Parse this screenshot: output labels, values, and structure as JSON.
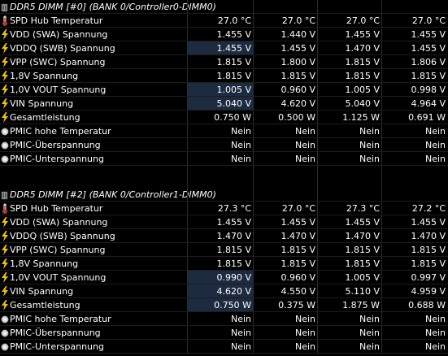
{
  "sections": [
    {
      "title": "DDR5 DIMM [#0] (BANK 0/Controller0-DIMM0)",
      "rows": [
        {
          "label": "SPD Hub Temperatur",
          "icon": "thermometer-icon",
          "values": [
            "27.0 °C",
            "27.0 °C",
            "27.0 °C",
            "27.0 °C"
          ]
        },
        {
          "label": "VDD (SWA) Spannung",
          "icon": "lightning-icon",
          "values": [
            "1.455 V",
            "1.440 V",
            "1.455 V",
            "1.455 V"
          ]
        },
        {
          "label": "VDDQ (SWB) Spannung",
          "icon": "lightning-icon",
          "values": [
            "1.455 V",
            "1.455 V",
            "1.470 V",
            "1.455 V"
          ],
          "highlight": true
        },
        {
          "label": "VPP (SWC) Spannung",
          "icon": "lightning-icon",
          "values": [
            "1.815 V",
            "1.800 V",
            "1.815 V",
            "1.806 V"
          ]
        },
        {
          "label": "1,8V Spannung",
          "icon": "lightning-icon",
          "values": [
            "1.815 V",
            "1.815 V",
            "1.815 V",
            "1.815 V"
          ]
        },
        {
          "label": "1,0V VOUT Spannung",
          "icon": "lightning-icon",
          "values": [
            "1.005 V",
            "0.960 V",
            "1.005 V",
            "0.998 V"
          ],
          "highlight": true
        },
        {
          "label": "VIN Spannung",
          "icon": "lightning-icon",
          "values": [
            "5.040 V",
            "4.620 V",
            "5.040 V",
            "4.964 V"
          ],
          "highlight": true
        },
        {
          "label": "Gesamtleistung",
          "icon": "lightning-icon",
          "values": [
            "0.750 W",
            "0.500 W",
            "1.125 W",
            "0.691 W"
          ]
        },
        {
          "label": "PMIC hohe Temperatur",
          "icon": "status-circle-icon",
          "values": [
            "Nein",
            "Nein",
            "Nein",
            "Nein"
          ]
        },
        {
          "label": "PMIC-Überspannung",
          "icon": "status-circle-icon",
          "values": [
            "Nein",
            "Nein",
            "Nein",
            "Nein"
          ]
        },
        {
          "label": "PMIC-Unterspannung",
          "icon": "status-circle-icon",
          "values": [
            "Nein",
            "Nein",
            "Nein",
            "Nein"
          ]
        }
      ]
    },
    {
      "title": "DDR5 DIMM [#2] (BANK 0/Controller1-DIMM0)",
      "rows": [
        {
          "label": "SPD Hub Temperatur",
          "icon": "thermometer-icon",
          "values": [
            "27.3 °C",
            "27.0 °C",
            "27.3 °C",
            "27.2 °C"
          ]
        },
        {
          "label": "VDD (SWA) Spannung",
          "icon": "lightning-icon",
          "values": [
            "1.455 V",
            "1.455 V",
            "1.455 V",
            "1.455 V"
          ]
        },
        {
          "label": "VDDQ (SWB) Spannung",
          "icon": "lightning-icon",
          "values": [
            "1.470 V",
            "1.470 V",
            "1.470 V",
            "1.470 V"
          ]
        },
        {
          "label": "VPP (SWC) Spannung",
          "icon": "lightning-icon",
          "values": [
            "1.815 V",
            "1.815 V",
            "1.815 V",
            "1.815 V"
          ]
        },
        {
          "label": "1,8V Spannung",
          "icon": "lightning-icon",
          "values": [
            "1.815 V",
            "1.815 V",
            "1.815 V",
            "1.815 V"
          ]
        },
        {
          "label": "1,0V VOUT Spannung",
          "icon": "lightning-icon",
          "values": [
            "0.990 V",
            "0.960 V",
            "1.005 V",
            "0.997 V"
          ],
          "highlight": true
        },
        {
          "label": "VIN Spannung",
          "icon": "lightning-icon",
          "values": [
            "4.620 V",
            "4.550 V",
            "5.110 V",
            "4.959 V"
          ],
          "highlight": true
        },
        {
          "label": "Gesamtleistung",
          "icon": "lightning-icon",
          "values": [
            "0.750 W",
            "0.375 W",
            "1.875 W",
            "0.688 W"
          ],
          "highlight": true
        },
        {
          "label": "PMIC hohe Temperatur",
          "icon": "status-circle-icon",
          "values": [
            "Nein",
            "Nein",
            "Nein",
            "Nein"
          ]
        },
        {
          "label": "PMIC-Überspannung",
          "icon": "status-circle-icon",
          "values": [
            "Nein",
            "Nein",
            "Nein",
            "Nein"
          ]
        },
        {
          "label": "PMIC-Unterspannung",
          "icon": "status-circle-icon",
          "values": [
            "Nein",
            "Nein",
            "Nein",
            "Nein"
          ]
        }
      ]
    }
  ],
  "colors": {
    "background": "#000000",
    "highlight": "#1d2b40",
    "bolt": "#e8c21a",
    "thermo": "#cc2a2a",
    "status": "#cfcfcf"
  }
}
